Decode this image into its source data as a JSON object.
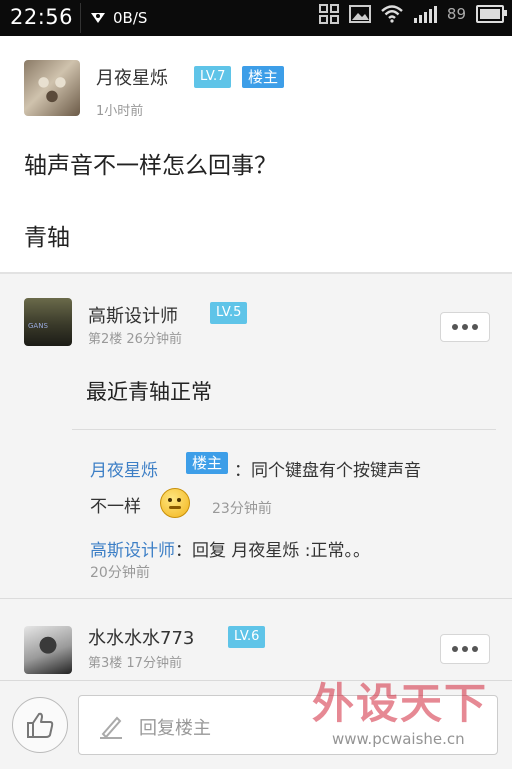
{
  "status_bar": {
    "time": "22:56",
    "net_speed": "0B/S",
    "battery_pct": "89",
    "icons": [
      "wifi-icon",
      "signal-icon",
      "battery-icon",
      "grid-icon",
      "image-icon",
      "location-icon"
    ]
  },
  "post": {
    "author": "月夜星烁",
    "level": "LV.7",
    "owner_badge": "楼主",
    "time": "1小时前",
    "lines": [
      "轴声音不一样怎么回事？",
      "青轴"
    ]
  },
  "replies": [
    {
      "author": "高斯设计师",
      "level": "LV.5",
      "floor_time": "第2楼  26分钟前",
      "avatar_text": "GANS",
      "body": "最近青轴正常",
      "sub_replies": [
        {
          "name": "月夜星烁",
          "badge": "楼主",
          "text": "：同个键盘有个按键声音",
          "text2": "不一样",
          "time": "23分钟前"
        },
        {
          "name": "高斯设计师",
          "text": "：回复 月夜星烁 :正常。。",
          "time": "20分钟前"
        }
      ]
    },
    {
      "author": "水水水水773",
      "level": "LV.6",
      "floor_time": "第3楼  17分钟前"
    }
  ],
  "bottom": {
    "reply_placeholder": "回复楼主"
  },
  "watermark": {
    "logo": "外设天下",
    "url": "www.pcwaishe.cn"
  },
  "colors": {
    "level_badge": "#5fc4e8",
    "owner_badge": "#3d9ee8",
    "link_name": "#3d7fc6",
    "status_bar": "#0b0b0b"
  }
}
